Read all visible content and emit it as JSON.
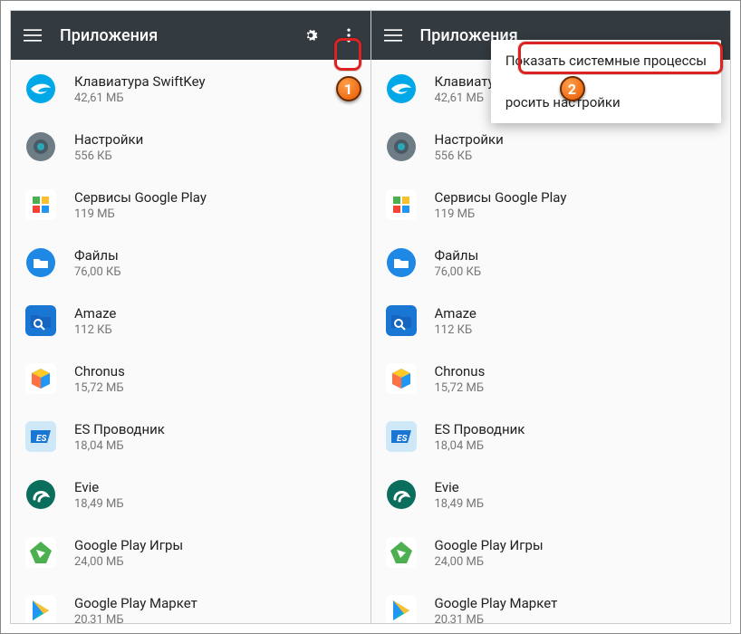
{
  "title": "Приложения",
  "menu": {
    "show_system": "Показать системные процессы",
    "reset": "росить настройки"
  },
  "badges": {
    "one": "1",
    "two": "2"
  },
  "apps": [
    {
      "name": "Клавиатура SwiftKey",
      "size": "42,61 МБ",
      "icon_bg": "#00a8e8",
      "glyph": "swift"
    },
    {
      "name": "Настройки",
      "size": "556 КБ",
      "icon_bg": "#6e7c85",
      "glyph": "gear"
    },
    {
      "name": "Сервисы Google Play",
      "size": "119 МБ",
      "icon_bg": "#ffffff",
      "glyph": "puzzle"
    },
    {
      "name": "Файлы",
      "size": "76,00 КБ",
      "icon_bg": "#1e88e5",
      "glyph": "folder"
    },
    {
      "name": "Amaze",
      "size": "112 КБ",
      "icon_bg": "#1976d2",
      "glyph": "foldermag"
    },
    {
      "name": "Chronus",
      "size": "15,72 МБ",
      "icon_bg": "#ffffff",
      "glyph": "cube"
    },
    {
      "name": "ES Проводник",
      "size": "18,04 МБ",
      "icon_bg": "#ffffff",
      "glyph": "es"
    },
    {
      "name": "Evie",
      "size": "18,49 МБ",
      "icon_bg": "#0b6e5c",
      "glyph": "curl"
    },
    {
      "name": "Google Play Игры",
      "size": "24,00 МБ",
      "icon_bg": "#ffffff",
      "glyph": "playg"
    },
    {
      "name": "Google Play Маркет",
      "size": "20,31 МБ",
      "icon_bg": "#ffffff",
      "glyph": "playm"
    }
  ]
}
